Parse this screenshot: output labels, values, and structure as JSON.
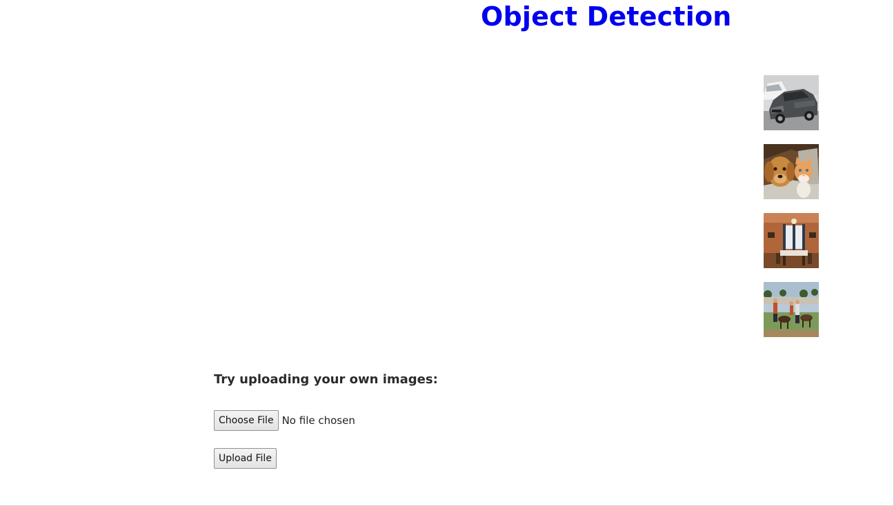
{
  "page": {
    "title": "Object Detection",
    "title_color": "#0000ee"
  },
  "samples": [
    {
      "icon": "car-thumbnail"
    },
    {
      "icon": "dog-and-cat-thumbnail"
    },
    {
      "icon": "dining-room-thumbnail"
    },
    {
      "icon": "people-with-horses-thumbnail"
    }
  ],
  "upload": {
    "heading": "Try uploading your own images:",
    "choose_label": "Choose File",
    "file_status": "No file chosen",
    "upload_label": "Upload File"
  }
}
